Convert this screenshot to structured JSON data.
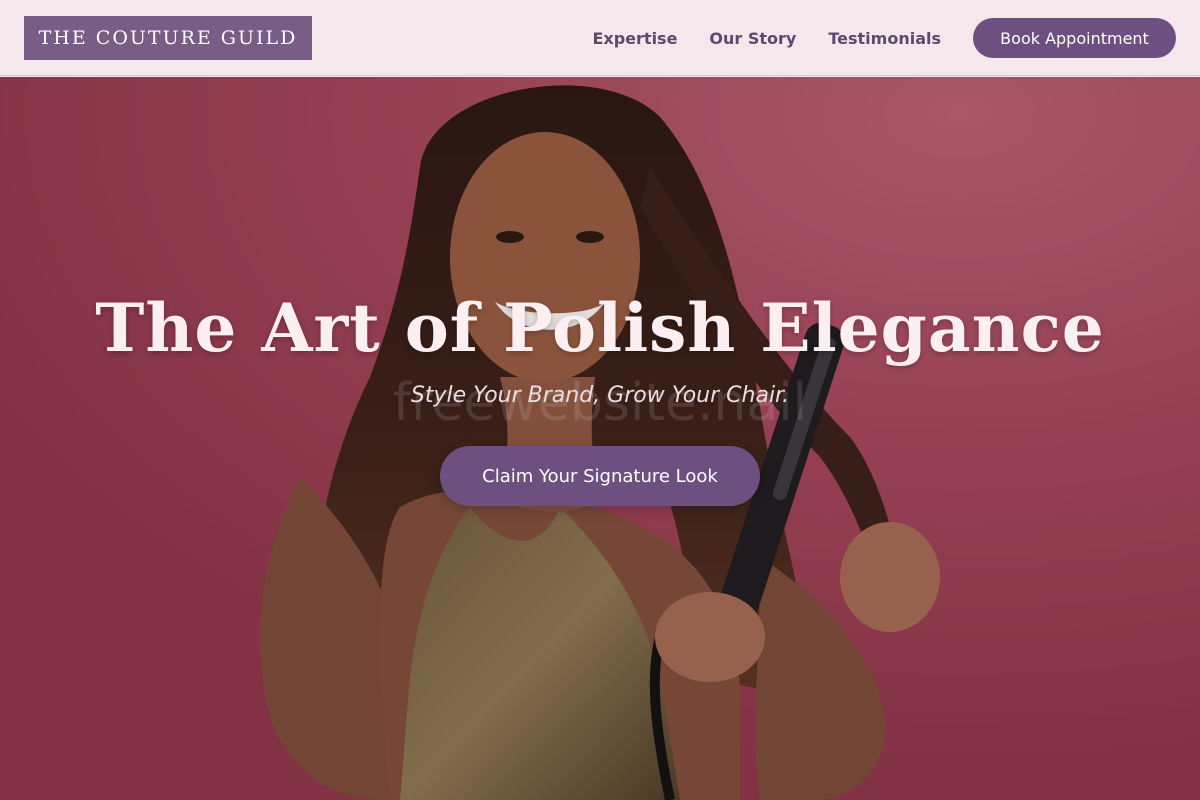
{
  "header": {
    "logo_text": "THE COUTURE GUILD",
    "nav": [
      "Expertise",
      "Our Story",
      "Testimonials"
    ],
    "cta_label": "Book Appointment"
  },
  "hero": {
    "title": "The Art of Polish Elegance",
    "subtitle": "Style Your Brand, Grow Your Chair.",
    "cta_label": "Claim Your Signature Look",
    "watermark": "freewebsite.nail",
    "image": "woman-styling-hair-with-flat-iron"
  },
  "colors": {
    "accent": "#6e5080",
    "logo_bg": "#7a5d87",
    "nav_bg": "#f4e8ec",
    "hero_bg": "#9c4156"
  }
}
